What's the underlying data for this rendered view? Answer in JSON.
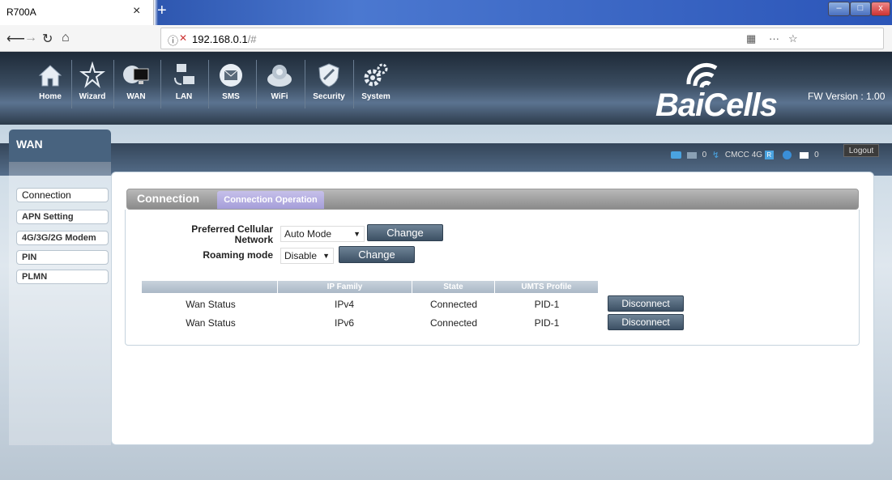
{
  "browser": {
    "tab_title": "R700A",
    "tab_close": "×",
    "new_tab": "+",
    "url_host": "192.168.0.1",
    "url_path": "/#",
    "window_controls": {
      "minimize": "–",
      "maximize": "□",
      "close": "x"
    }
  },
  "app": {
    "nav": [
      {
        "label": "Home",
        "icon": "home-icon"
      },
      {
        "label": "Wizard",
        "icon": "wizard-icon"
      },
      {
        "label": "WAN",
        "icon": "wan-icon"
      },
      {
        "label": "LAN",
        "icon": "lan-icon"
      },
      {
        "label": "SMS",
        "icon": "sms-icon"
      },
      {
        "label": "WiFi",
        "icon": "wifi-icon"
      },
      {
        "label": "Security",
        "icon": "security-icon"
      },
      {
        "label": "System",
        "icon": "system-icon"
      }
    ],
    "logo": "BaiCells",
    "fw_version": "FW Version : 1.00",
    "page_title": "WAN",
    "status": {
      "sms_count": "0",
      "carrier": "CMCC",
      "network": "4G",
      "roaming_badge": "R",
      "message_count": "0"
    },
    "logout_label": "Logout"
  },
  "sidebar": {
    "items": [
      {
        "label": "Connection",
        "active": true
      },
      {
        "label": "APN Setting"
      },
      {
        "label": "4G/3G/2G Modem"
      },
      {
        "label": "PIN"
      },
      {
        "label": "PLMN"
      }
    ]
  },
  "main": {
    "section_title": "Connection",
    "section_tab": "Connection Operation",
    "preferred_label": "Preferred Cellular Network",
    "preferred_value": "Auto Mode",
    "preferred_change": "Change",
    "roaming_label": "Roaming mode",
    "roaming_value": "Disable",
    "roaming_change": "Change",
    "table": {
      "headers": [
        "",
        "IP Family",
        "State",
        "UMTS Profile"
      ],
      "rows": [
        {
          "name": "Wan Status",
          "family": "IPv4",
          "state": "Connected",
          "profile": "PID-1",
          "action": "Disconnect"
        },
        {
          "name": "Wan Status",
          "family": "IPv6",
          "state": "Connected",
          "profile": "PID-1",
          "action": "Disconnect"
        }
      ]
    }
  },
  "colors": {
    "header_dark": "#1e2a38",
    "button": "#4a5e72",
    "tab_active": "#a59ed9"
  }
}
